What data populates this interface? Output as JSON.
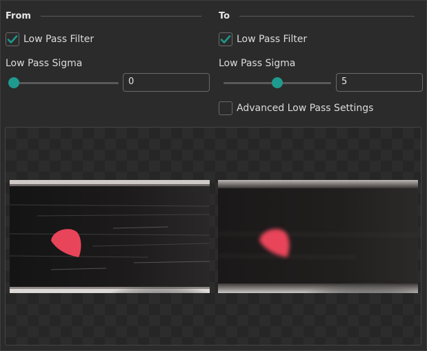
{
  "from": {
    "title": "From",
    "low_pass_filter": {
      "label": "Low Pass Filter",
      "checked": true
    },
    "sigma": {
      "label": "Low Pass Sigma",
      "value": "0",
      "slider_fraction": 0.0
    }
  },
  "to": {
    "title": "To",
    "low_pass_filter": {
      "label": "Low Pass Filter",
      "checked": true
    },
    "sigma": {
      "label": "Low Pass Sigma",
      "value": "5",
      "slider_fraction": 0.5
    },
    "advanced": {
      "label": "Advanced Low Pass Settings",
      "checked": false
    }
  },
  "colors": {
    "accent": "#1f9a8e",
    "blob": "#e8445a",
    "background": "#2b2b2b"
  }
}
